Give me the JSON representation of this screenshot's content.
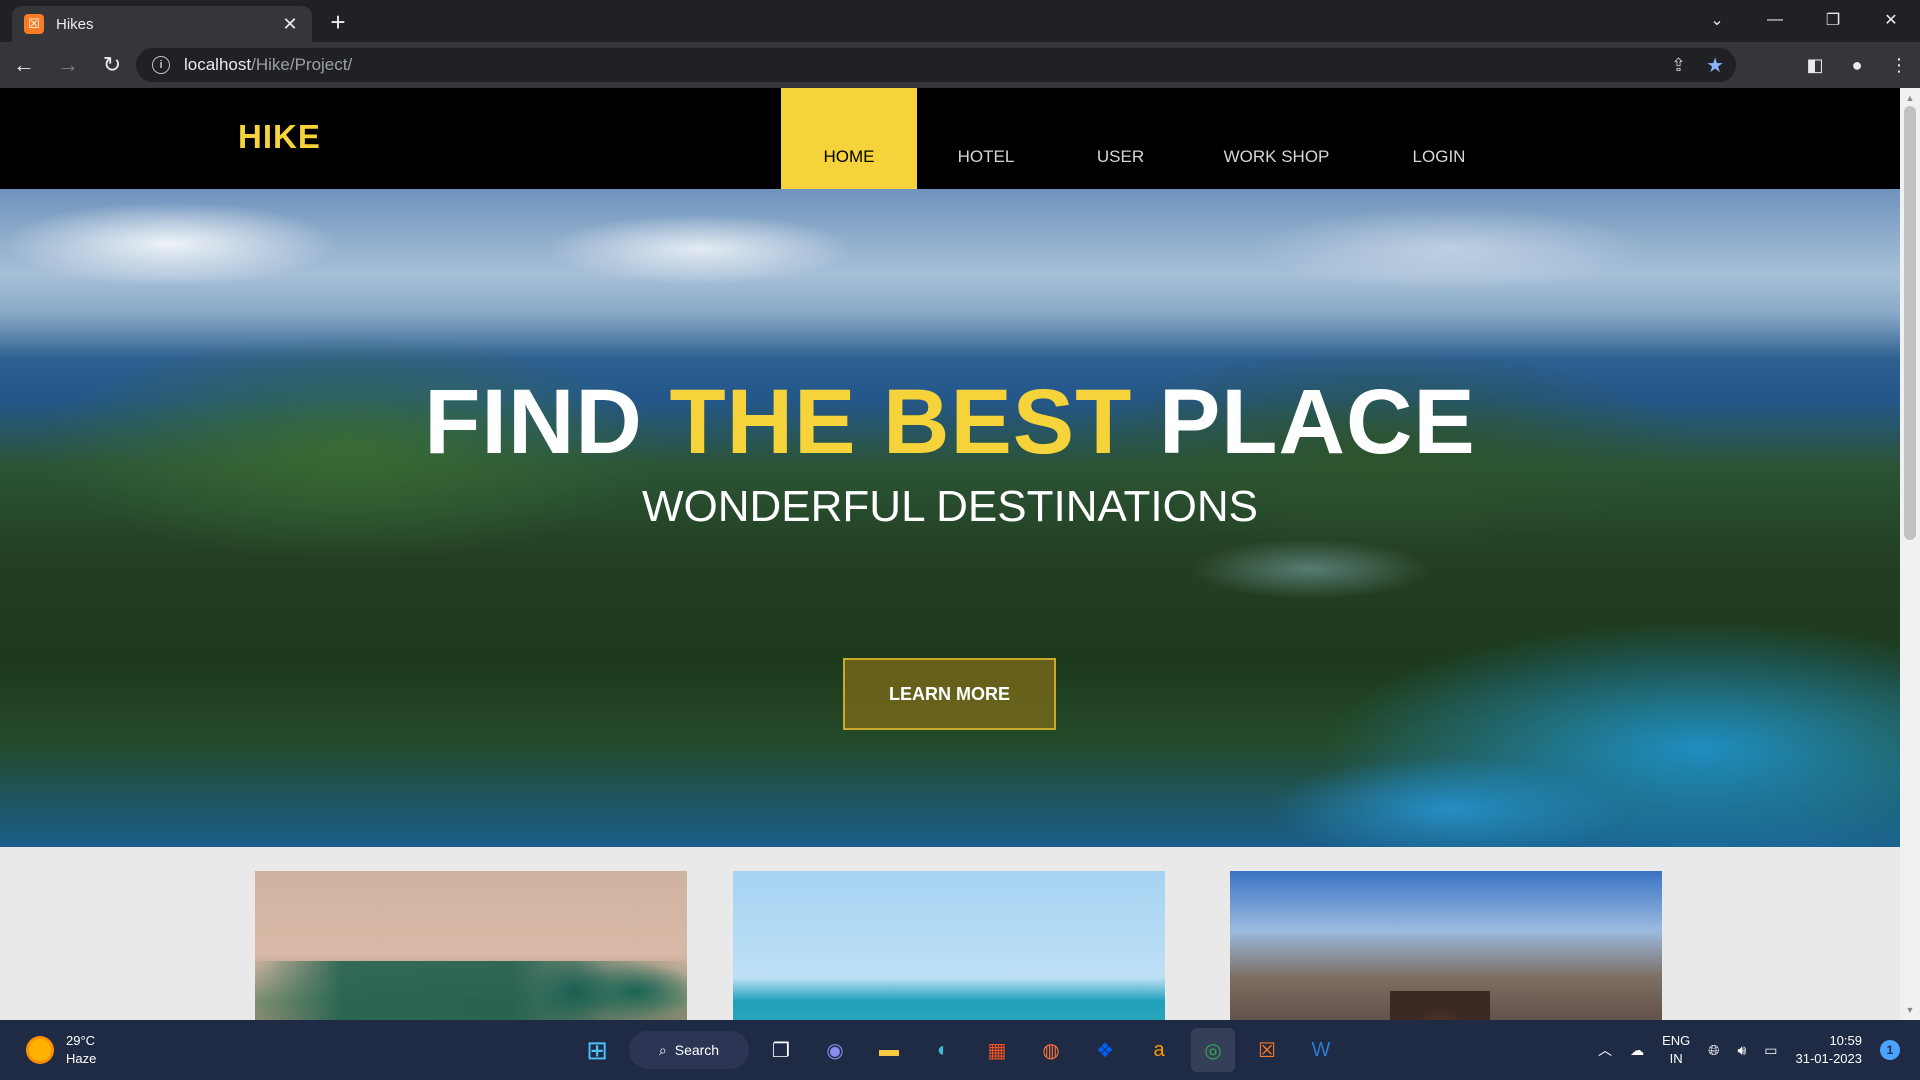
{
  "browser": {
    "tab": {
      "title": "Hikes",
      "favicon": "xampp-icon"
    },
    "address": {
      "host": "localhost",
      "path": "/Hike/Project/"
    }
  },
  "site": {
    "logo": "HIKE",
    "nav": [
      {
        "label": "HOME",
        "active": true
      },
      {
        "label": "HOTEL",
        "active": false
      },
      {
        "label": "USER",
        "active": false
      },
      {
        "label": "WORK SHOP",
        "active": false
      },
      {
        "label": "LOGIN",
        "active": false
      }
    ],
    "hero": {
      "title_part1": "FIND",
      "title_accent": "THE BEST",
      "title_part2": "PLACE",
      "subtitle": "WONDERFUL DESTINATIONS",
      "button": "LEARN MORE"
    },
    "cards": [
      {
        "image": "backwaters-palm-trees-photo"
      },
      {
        "image": "beach-parasailing-photo"
      },
      {
        "image": "mountain-lake-traveler-photo"
      }
    ],
    "accent_color": "#f6d33a"
  },
  "taskbar": {
    "weather": {
      "temp": "29°C",
      "condition": "Haze"
    },
    "search": "Search",
    "lang": {
      "line1": "ENG",
      "line2": "IN"
    },
    "clock": {
      "time": "10:59",
      "date": "31-01-2023"
    },
    "notifications": "1"
  }
}
